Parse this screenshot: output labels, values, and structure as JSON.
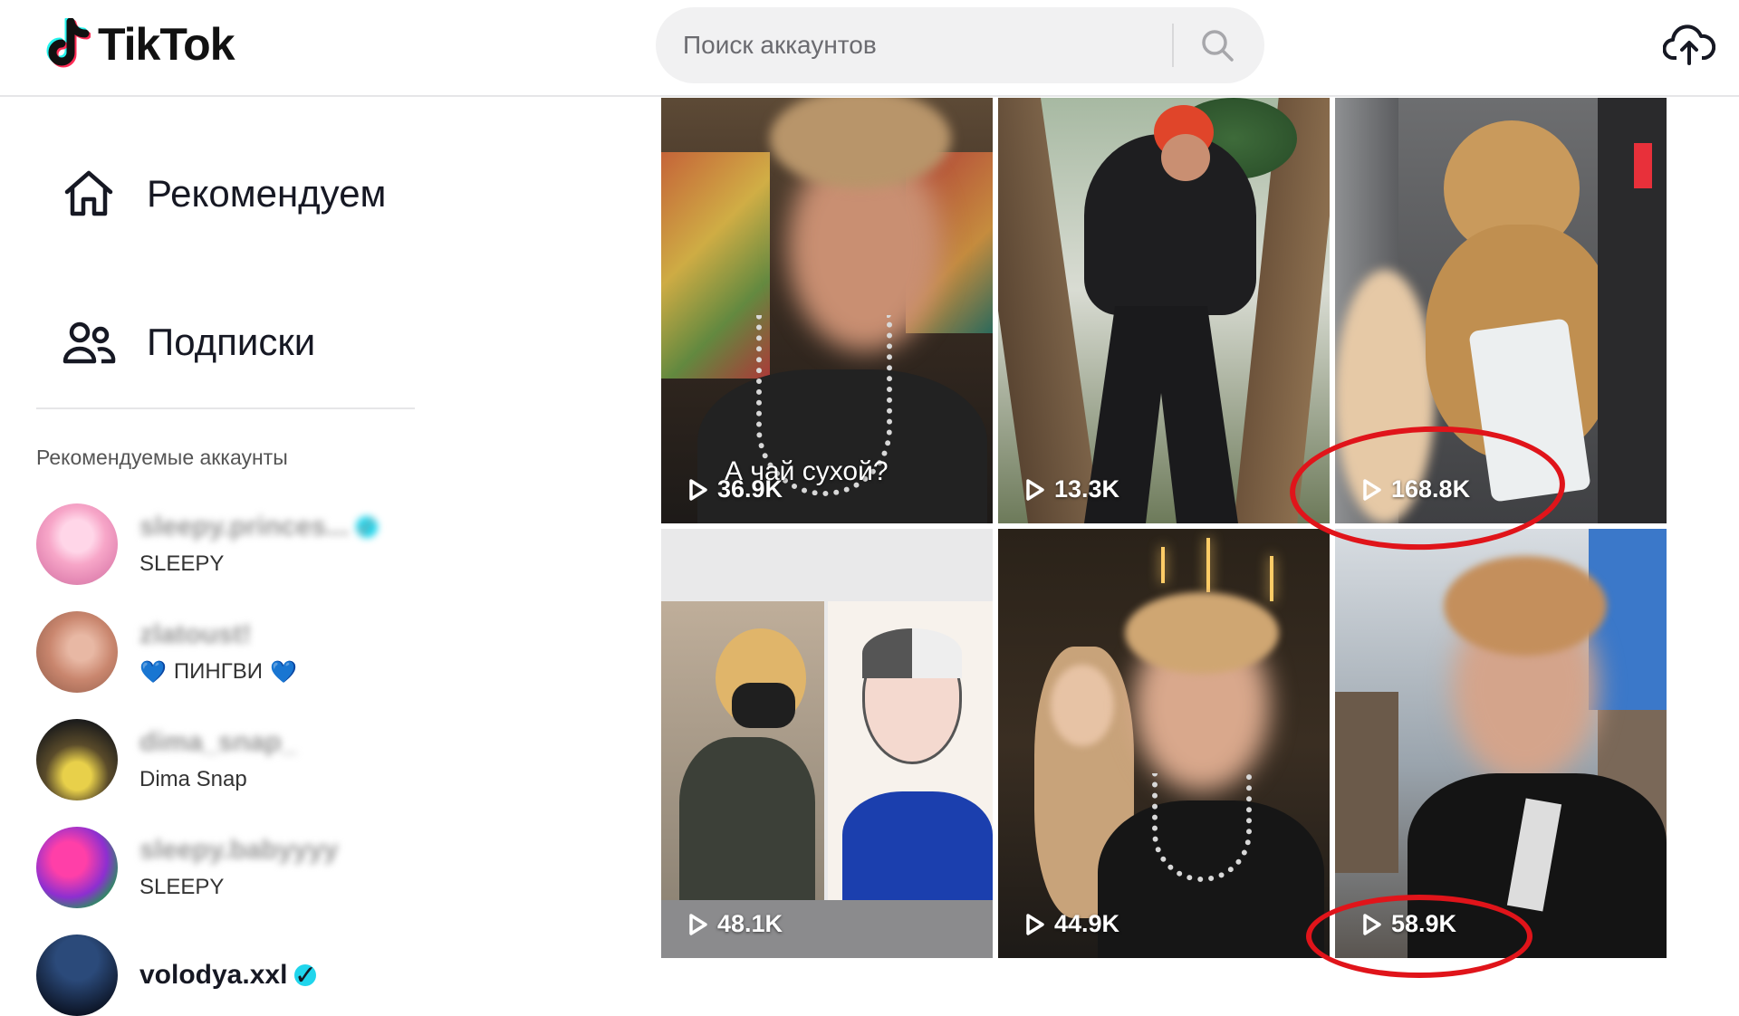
{
  "header": {
    "logo_text": "TikTok",
    "search_placeholder": "Поиск аккаунтов",
    "icons": [
      "tiktok-logo-icon",
      "search-icon",
      "upload-cloud-icon"
    ]
  },
  "sidebar": {
    "nav": [
      {
        "label": "Рекомендуем",
        "icon": "home-icon"
      },
      {
        "label": "Подписки",
        "icon": "following-icon"
      }
    ],
    "section_title": "Рекомендуемые аккаунты",
    "accounts": [
      {
        "username": "sleepy.princes...",
        "name": "SLEEPY",
        "verified": true
      },
      {
        "username": "zlatoust!",
        "name": "ПИНГВИ",
        "verified": false,
        "name_emoji": "💙"
      },
      {
        "username": "dima_snap_",
        "name": "Dima Snap",
        "verified": false
      },
      {
        "username": "sleepy.babyyyy",
        "name": "SLEEPY",
        "verified": false
      },
      {
        "username": "volodya.xxl",
        "name": "",
        "verified": true
      }
    ]
  },
  "videos": [
    {
      "views": "36.9K",
      "caption": "А чай сухой?"
    },
    {
      "views": "13.3K",
      "caption": ""
    },
    {
      "views": "168.8K",
      "caption": "",
      "highlighted": true
    },
    {
      "views": "48.1K",
      "caption": ""
    },
    {
      "views": "44.9K",
      "caption": ""
    },
    {
      "views": "58.9K",
      "caption": "",
      "highlighted": true
    }
  ],
  "colors": {
    "accent_red": "#e0141a",
    "verified": "#20d5ec",
    "search_bg": "#f1f1f2"
  }
}
